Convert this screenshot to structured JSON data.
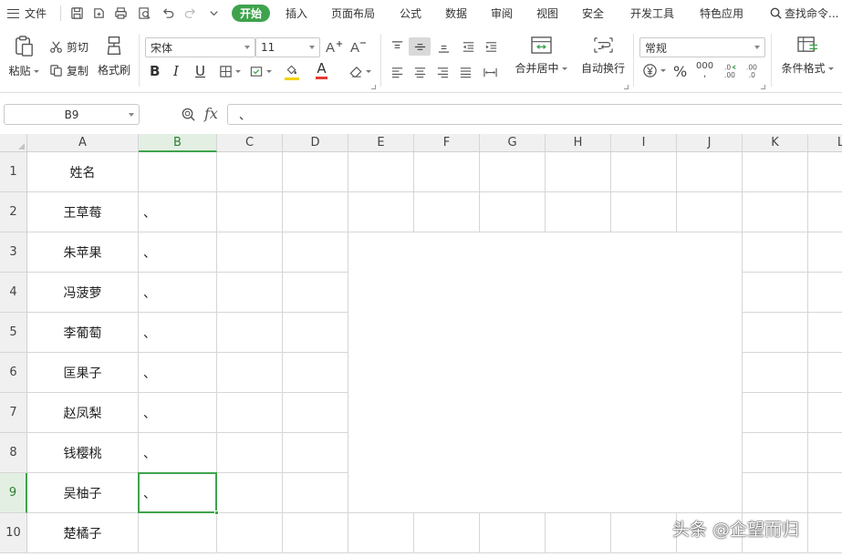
{
  "menubar": {
    "file_label": "文件",
    "tabs": [
      {
        "label": "开始",
        "active": true
      },
      {
        "label": "插入"
      },
      {
        "label": "页面布局"
      },
      {
        "label": "公式"
      },
      {
        "label": "数据"
      },
      {
        "label": "审阅"
      },
      {
        "label": "视图"
      },
      {
        "label": "安全"
      },
      {
        "label": "开发工具"
      },
      {
        "label": "特色应用"
      }
    ],
    "search_label": "查找命令..."
  },
  "ribbon": {
    "paste_label": "粘贴",
    "cut_label": "剪切",
    "copy_label": "复制",
    "format_painter_label": "格式刷",
    "font_name": "宋体",
    "font_size": "11",
    "bold": "B",
    "italic": "I",
    "underline": "U",
    "font_color_letter": "A",
    "merge_center_label": "合并居中",
    "wrap_text_label": "自动换行",
    "number_format": "常规",
    "percent_symbol": "%",
    "thousands_symbol": "000",
    "conditional_format_label": "条件格式",
    "accent_color": "#3fa34d",
    "font_color_bar": "#e53935",
    "fill_color_bar": "#f5d300"
  },
  "formulabar": {
    "cell_ref": "B9",
    "fx_label": "fx",
    "formula_value": "、"
  },
  "sheet": {
    "columns": [
      "A",
      "B",
      "C",
      "D",
      "E",
      "F",
      "G",
      "H",
      "I",
      "J",
      "K",
      "L"
    ],
    "selected_column": "B",
    "rows": [
      {
        "num": "1",
        "a": "姓名",
        "b": ""
      },
      {
        "num": "2",
        "a": "王草莓",
        "b": "、"
      },
      {
        "num": "3",
        "a": "朱苹果",
        "b": "、"
      },
      {
        "num": "4",
        "a": "冯菠萝",
        "b": "、"
      },
      {
        "num": "5",
        "a": "李葡萄",
        "b": "、"
      },
      {
        "num": "6",
        "a": "匡果子",
        "b": "、"
      },
      {
        "num": "7",
        "a": "赵凤梨",
        "b": "、"
      },
      {
        "num": "8",
        "a": "钱樱桃",
        "b": "、"
      },
      {
        "num": "9",
        "a": "吴柚子",
        "b": "、"
      },
      {
        "num": "10",
        "a": "楚橘子",
        "b": ""
      }
    ],
    "selected_row": "9"
  },
  "watermark": "头条 @企望而归"
}
